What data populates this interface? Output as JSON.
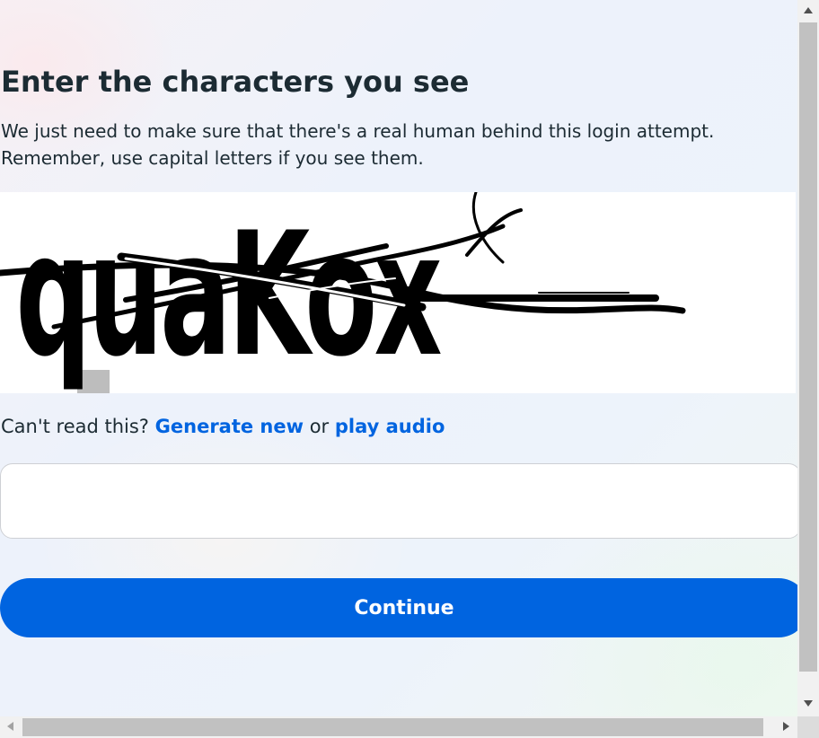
{
  "page": {
    "title": "Enter the characters you see",
    "subtitle_line1": "We just need to make sure that there's a real human behind this login attempt.",
    "subtitle_line2": "Remember, use capital letters if you see them."
  },
  "captcha": {
    "text": "quaKox"
  },
  "help": {
    "prefix": "Can't read this? ",
    "generate_label": "Generate new",
    "or_text": " or ",
    "audio_label": "play audio"
  },
  "input": {
    "value": "",
    "placeholder": ""
  },
  "continue_label": "Continue",
  "colors": {
    "accent": "#0064e0",
    "text": "#1c2b33",
    "input_border": "#ced0d4"
  }
}
